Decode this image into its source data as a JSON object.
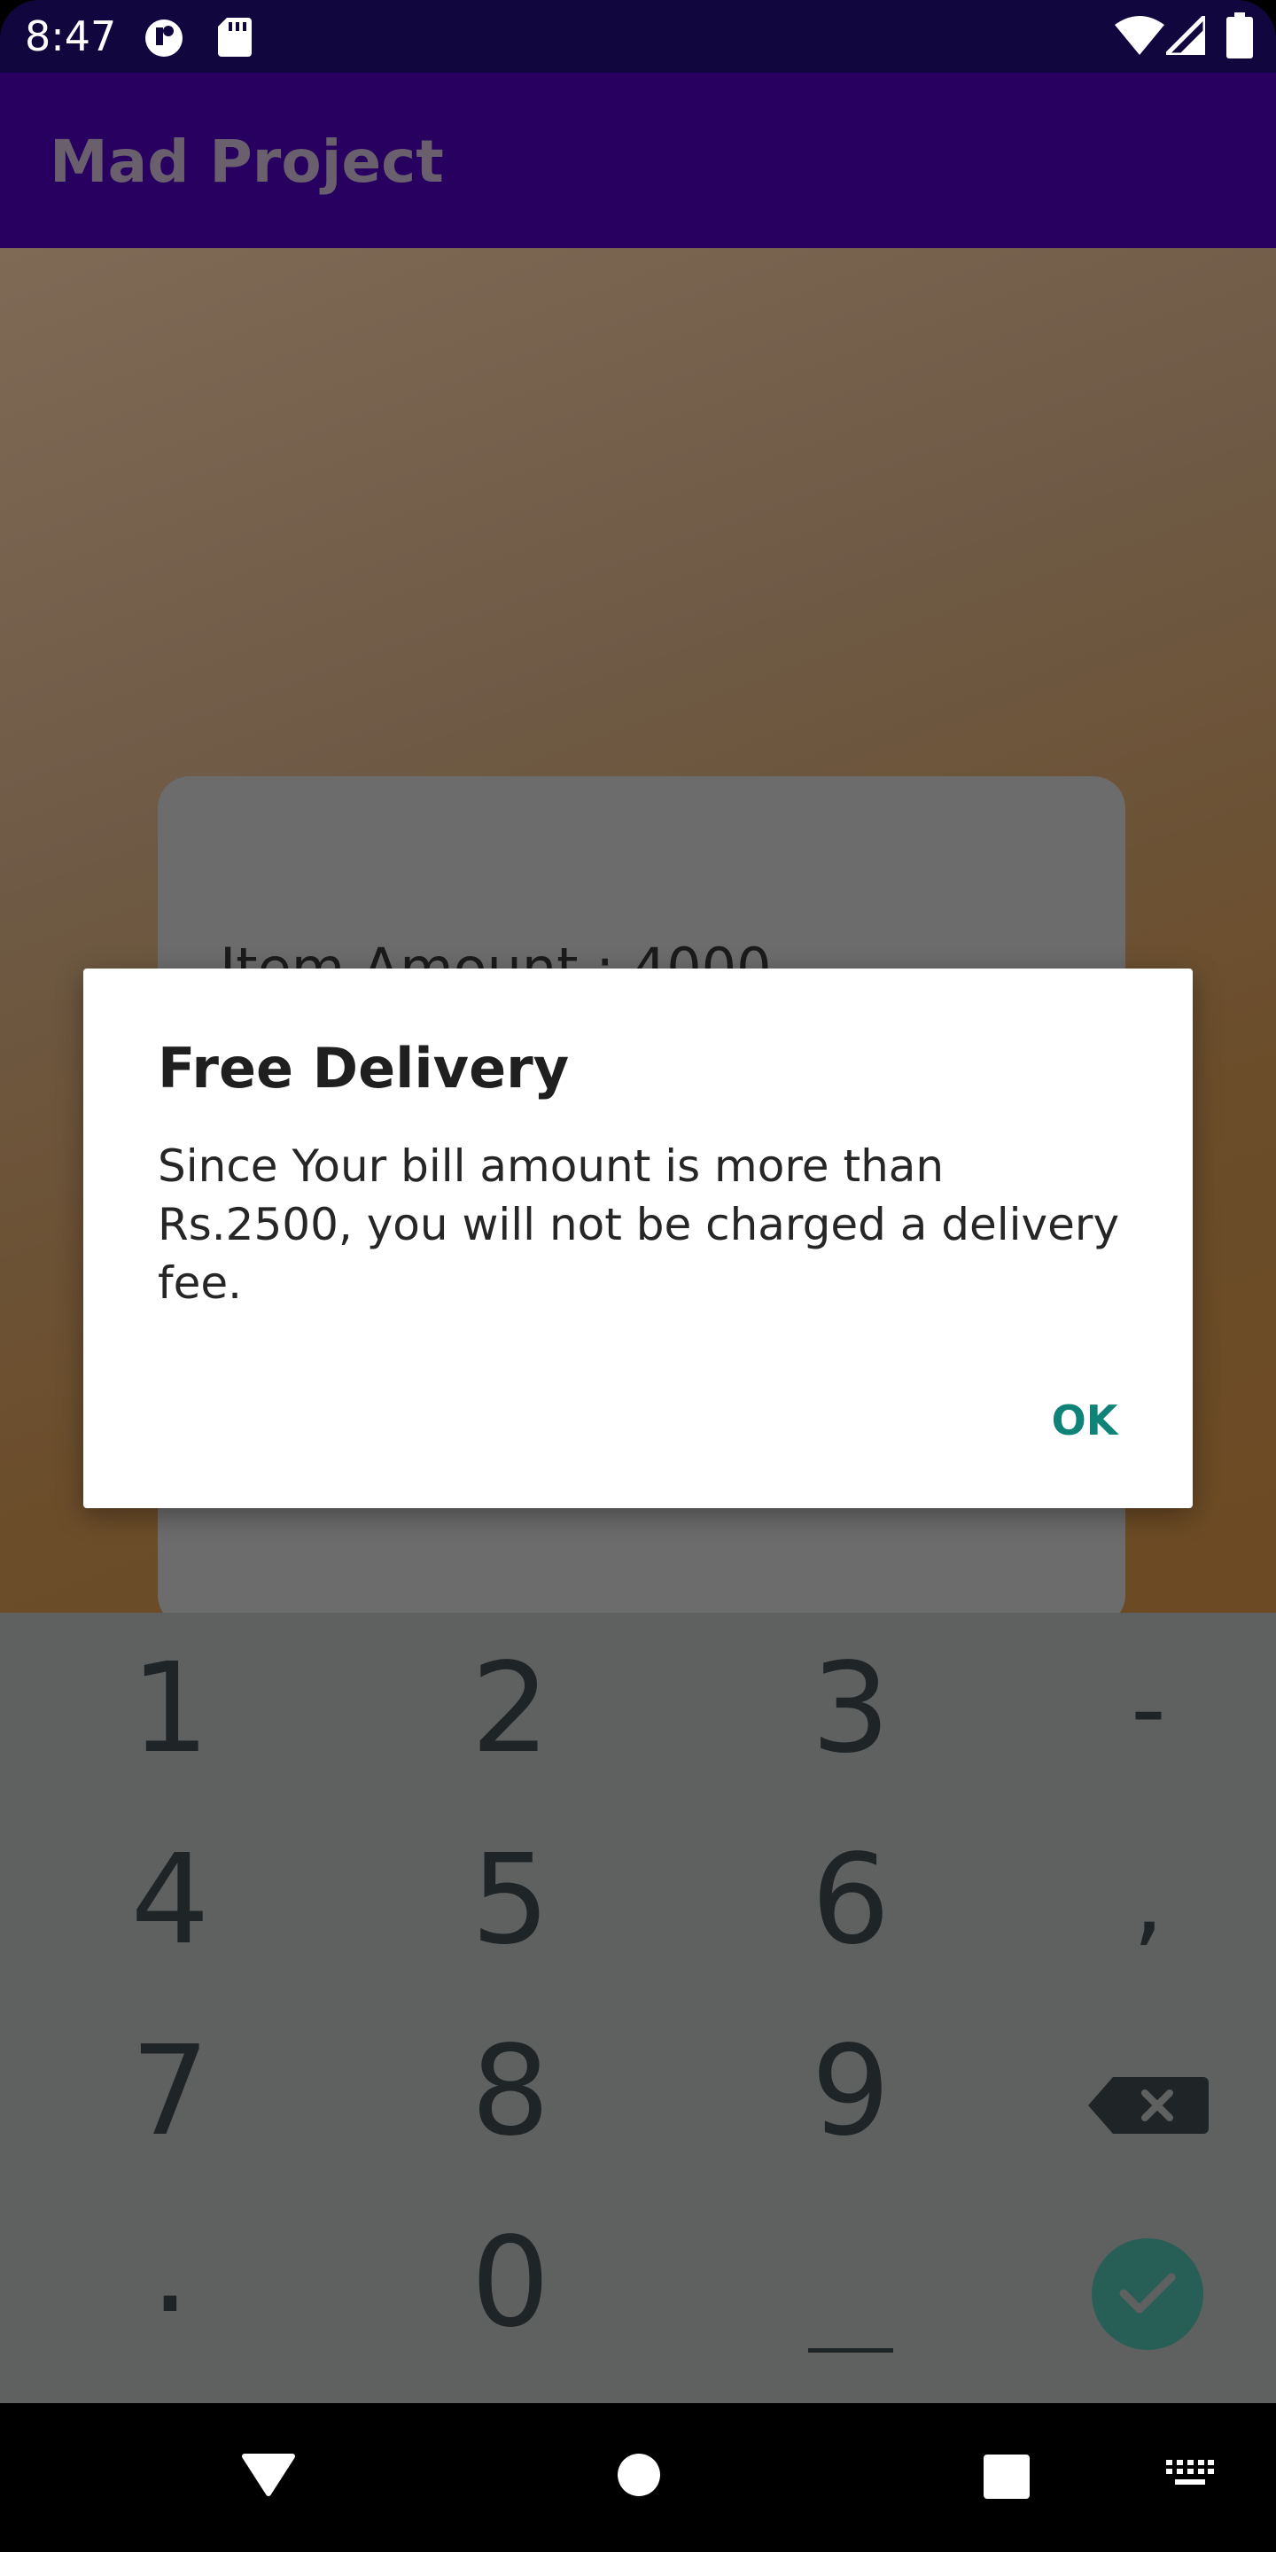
{
  "status_bar": {
    "time": "8:47",
    "icons": [
      "notification-icon",
      "sd-card-icon",
      "wifi-icon",
      "signal-icon",
      "battery-icon"
    ]
  },
  "app_bar": {
    "title": "Mad Project"
  },
  "content": {
    "item_amount_label": "Item Amount : 4000"
  },
  "dialog": {
    "title": "Free Delivery",
    "message": "Since Your bill amount is more than Rs.2500, you will not be charged a delivery fee.",
    "ok_label": "OK"
  },
  "keyboard": {
    "keys": [
      [
        "1",
        "2",
        "3",
        "-"
      ],
      [
        "4",
        "5",
        "6",
        ","
      ],
      [
        "7",
        "8",
        "9",
        "⌫"
      ],
      [
        ".",
        "0",
        " ",
        "✓"
      ]
    ]
  },
  "nav_bar": {
    "icons": [
      "back-icon",
      "home-icon",
      "recents-icon",
      "keyboard-switch-icon"
    ]
  },
  "colors": {
    "status_bar": "#12063f",
    "app_bar": "#280160",
    "accent": "#0f8377",
    "keyboard": "#5f6160"
  }
}
